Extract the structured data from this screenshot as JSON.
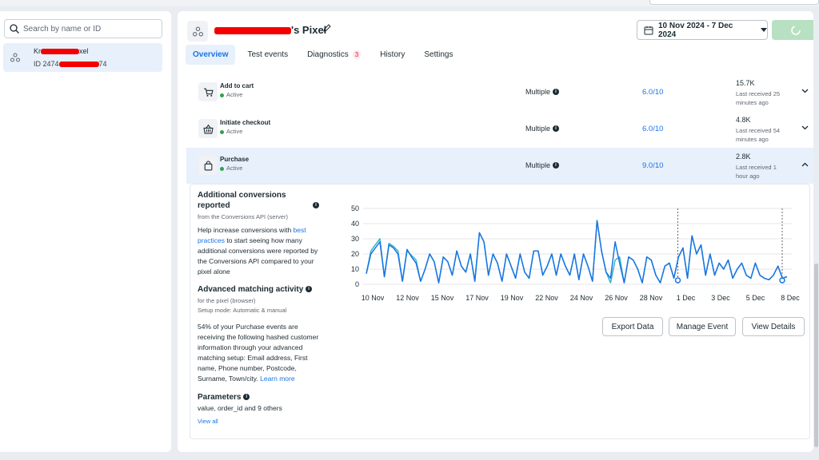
{
  "search": {
    "placeholder": "Search by name or ID"
  },
  "pixel_list": {
    "name_prefix": "Kr",
    "name_suffix": "xel",
    "id_prefix": "ID 2474",
    "id_suffix": "74"
  },
  "header": {
    "title_suffix": "'s Pixel",
    "date_range": "10 Nov 2024 - 7 Dec 2024"
  },
  "tabs": [
    {
      "label": "Overview",
      "active": true
    },
    {
      "label": "Test events"
    },
    {
      "label": "Diagnostics",
      "badge": "3"
    },
    {
      "label": "History"
    },
    {
      "label": "Settings"
    }
  ],
  "events": [
    {
      "name": "Add to cart",
      "status": "Active",
      "integration": "Multiple",
      "score": "6.0/10",
      "count": "15.7K",
      "received": "Last received 25 minutes ago"
    },
    {
      "name": "Initiate checkout",
      "status": "Active",
      "integration": "Multiple",
      "score": "6.0/10",
      "count": "4.8K",
      "received": "Last received 54 minutes ago"
    },
    {
      "name": "Purchase",
      "status": "Active",
      "integration": "Multiple",
      "score": "9.0/10",
      "count": "2.8K",
      "received": "Last received 1 hour ago"
    }
  ],
  "detail": {
    "additional": {
      "title": "Additional conversions reported",
      "source": "from the Conversions API (server)",
      "text_before": "Help increase conversions with ",
      "link": "best practices",
      "text_after": " to start seeing how many additional conversions were reported by the Conversions API compared to your pixel alone"
    },
    "matching": {
      "title": "Advanced matching activity",
      "source": "for the pixel (browser)",
      "mode": "Setup mode: Automatic & manual",
      "text": "54% of your Purchase events are receiving the following hashed customer information through your advanced matching setup: Email address, First name, Phone number, Postcode, Surname, Town/city. ",
      "link": "Learn more"
    },
    "parameters": {
      "title": "Parameters",
      "text": "value, order_id and 9 others",
      "link": "View all"
    },
    "buttons": {
      "export": "Export Data",
      "manage": "Manage Event",
      "details": "View Details"
    }
  },
  "chart_data": {
    "type": "line",
    "x_tick_labels": [
      "10 Nov",
      "12 Nov",
      "15 Nov",
      "17 Nov",
      "19 Nov",
      "22 Nov",
      "24 Nov",
      "26 Nov",
      "28 Nov",
      "1 Dec",
      "3 Dec",
      "5 Dec",
      "8 Dec"
    ],
    "y_ticks": [
      0,
      10,
      20,
      30,
      40,
      50
    ],
    "ylim": [
      0,
      50
    ],
    "series": [
      {
        "color": "#1b74e4",
        "values": [
          7,
          20,
          24,
          28,
          5,
          26,
          24,
          20,
          2,
          23,
          18,
          14,
          2,
          10,
          20,
          15,
          1,
          18,
          15,
          6,
          22,
          12,
          8,
          20,
          2,
          34,
          28,
          6,
          20,
          14,
          2,
          20,
          12,
          4,
          20,
          8,
          4,
          22,
          22,
          6,
          12,
          20,
          6,
          20,
          12,
          6,
          20,
          3,
          20,
          12,
          2,
          42,
          22,
          8,
          4,
          28,
          14,
          1,
          18,
          16,
          10,
          1,
          18,
          16,
          6,
          1,
          12,
          14,
          4,
          18,
          24,
          4,
          32,
          20,
          26,
          6,
          20,
          6,
          14,
          10,
          16,
          4,
          10,
          14,
          6,
          4,
          14,
          6,
          4,
          3,
          6,
          12,
          4,
          5
        ]
      },
      {
        "color": "#36b3c9",
        "values": [
          7,
          22,
          26,
          30,
          5,
          27,
          25,
          22,
          2,
          22,
          19,
          16,
          2,
          10,
          20,
          15,
          1,
          18,
          15,
          6,
          22,
          12,
          8,
          20,
          2,
          34,
          28,
          6,
          20,
          14,
          2,
          20,
          12,
          4,
          20,
          8,
          4,
          22,
          22,
          6,
          12,
          20,
          6,
          20,
          12,
          6,
          20,
          3,
          20,
          12,
          2,
          42,
          22,
          8,
          1,
          16,
          18,
          1,
          18,
          16,
          10,
          1,
          18,
          16,
          6,
          1,
          12,
          14,
          4,
          18,
          24,
          4,
          32,
          20,
          26,
          6,
          20,
          6,
          14,
          10,
          16,
          4,
          10,
          14,
          6,
          4,
          14,
          6,
          4,
          3,
          6,
          12,
          4,
          5
        ]
      }
    ],
    "markers": [
      "1 Dec",
      "8 Dec"
    ]
  }
}
